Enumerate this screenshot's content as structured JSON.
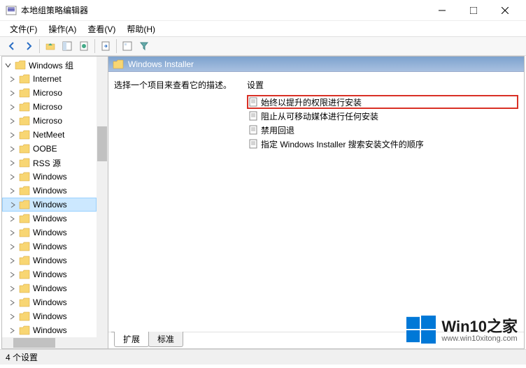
{
  "window": {
    "title": "本地组策略编辑器"
  },
  "menu": {
    "file": "文件(F)",
    "action": "操作(A)",
    "view": "查看(V)",
    "help": "帮助(H)"
  },
  "tree": {
    "top": "Windows 组",
    "items": [
      "Internet",
      "Microso",
      "Microso",
      "Microso",
      "NetMeet",
      "OOBE",
      "RSS 源",
      "Windows",
      "Windows",
      "Windows",
      "Windows",
      "Windows",
      "Windows",
      "Windows",
      "Windows",
      "Windows",
      "Windows",
      "Windows",
      "Windows"
    ],
    "selected_index": 9
  },
  "content": {
    "header": "Windows Installer",
    "desc_prompt": "选择一个项目来查看它的描述。",
    "settings_head": "设置",
    "settings": [
      "始终以提升的权限进行安装",
      "阻止从可移动媒体进行任何安装",
      "禁用回退",
      "指定 Windows Installer 搜索安装文件的顺序"
    ],
    "highlighted_index": 0
  },
  "tabs": {
    "extended": "扩展",
    "standard": "标准"
  },
  "status": {
    "text": "4 个设置"
  },
  "watermark": {
    "brand": "Win10之家",
    "url": "www.win10xitong.com"
  }
}
